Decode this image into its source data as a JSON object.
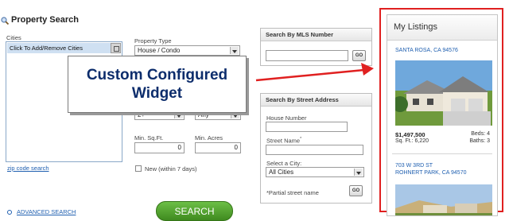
{
  "search": {
    "title": "Property Search",
    "cities_label": "Cities",
    "cities_value": "Click To Add/Remove Cities",
    "property_type_label": "Property Type",
    "property_type_value": "House / Condo",
    "beds_value": "2+",
    "baths_value": "Any",
    "min_sqft_label": "Min. Sq.Ft.",
    "min_sqft_value": "0",
    "min_acres_label": "Min. Acres",
    "min_acres_value": "0",
    "new_label": "New (within 7 days)",
    "zip_link": "zip code search",
    "advanced_link": "ADVANCED SEARCH",
    "search_button": "SEARCH"
  },
  "mls": {
    "title": "Search By MLS Number",
    "go": "GO"
  },
  "street": {
    "title": "Search By Street Address",
    "house_number_label": "House Number",
    "street_name_label": "Street Name",
    "street_name_mark": "*",
    "city_label": "Select a City:",
    "city_value": "All Cities",
    "partial_note": "*Partial street name",
    "go": "GO"
  },
  "callout": {
    "line1": "Custom Configured",
    "line2": "Widget"
  },
  "listings": {
    "title": "My Listings",
    "items": [
      {
        "address": "SANTA ROSA, CA 94576",
        "price": "$1,497,500",
        "sqft": "Sq. Ft.: 6,220",
        "beds": "Beds: 4",
        "baths": "Baths: 3"
      },
      {
        "street": "703 W 3RD ST",
        "address": "ROHNERT PARK, CA 94570"
      }
    ]
  },
  "colors": {
    "accent_red": "#e02020",
    "link_blue": "#1f5fb0",
    "callout_navy": "#0d2d6c",
    "search_green": "#4c9a2a"
  }
}
